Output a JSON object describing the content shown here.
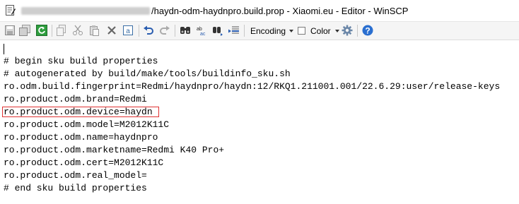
{
  "window": {
    "title_visible": "/haydn-odm-haydnpro.build.prop - Xiaomi.eu - Editor - WinSCP"
  },
  "toolbar": {
    "encoding_label": "Encoding",
    "color_label": "Color",
    "encoding_checked": false,
    "icons": [
      "save-icon",
      "save-all-icon",
      "reload-icon",
      "copy-icon",
      "cut-icon",
      "paste-icon",
      "delete-icon",
      "select-all-icon",
      "undo-icon",
      "redo-icon",
      "find-icon",
      "replace-icon",
      "find-next-icon",
      "go-to-line-icon",
      "settings-icon",
      "help-icon"
    ]
  },
  "editor": {
    "lines": [
      "",
      "# begin sku build properties",
      "# autogenerated by build/make/tools/buildinfo_sku.sh",
      "ro.odm.build.fingerprint=Redmi/haydnpro/haydn:12/RKQ1.211001.001/22.6.29:user/release-keys",
      "ro.product.odm.brand=Redmi",
      "ro.product.odm.device=haydn",
      "ro.product.odm.model=M2012K11C",
      "ro.product.odm.name=haydnpro",
      "ro.product.odm.marketname=Redmi K40 Pro+",
      "ro.product.odm.cert=M2012K11C",
      "ro.product.odm.real_model=",
      "# end sku build properties"
    ],
    "highlighted_line_index": 5,
    "highlight_color": "#e03232"
  }
}
